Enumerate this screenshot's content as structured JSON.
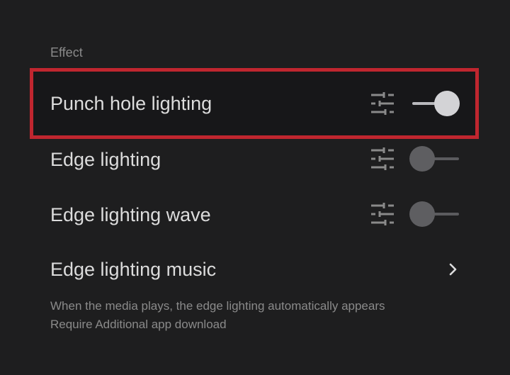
{
  "section": {
    "label": "Effect"
  },
  "items": [
    {
      "label": "Punch hole lighting",
      "toggle_on": true,
      "has_settings": true,
      "highlighted": true
    },
    {
      "label": "Edge lighting",
      "toggle_on": false,
      "has_settings": true
    },
    {
      "label": "Edge lighting wave",
      "toggle_on": false,
      "has_settings": true
    },
    {
      "label": "Edge lighting music",
      "has_chevron": true
    }
  ],
  "music_description": {
    "line1": "When the media plays, the edge lighting automatically appears",
    "line2": "Require Additional app download"
  },
  "colors": {
    "background": "#1e1e1f",
    "highlight_border": "#c0262f",
    "text_primary": "#dcdcdc",
    "text_secondary": "#8a8a8a"
  },
  "icons": {
    "settings": "sliders-icon",
    "navigate": "chevron-right-icon"
  }
}
